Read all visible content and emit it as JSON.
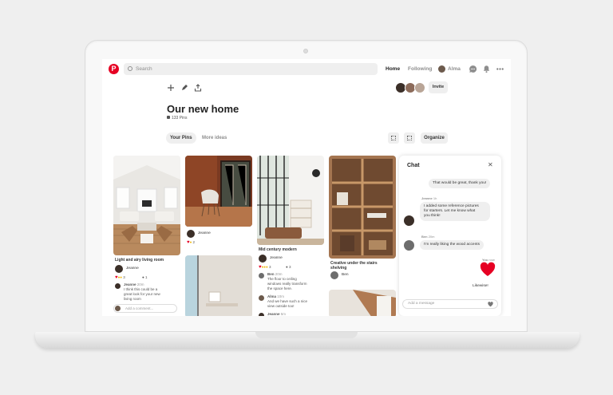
{
  "topbar": {
    "search_placeholder": "Search",
    "nav": {
      "home": "Home",
      "following": "Following",
      "user": "Alma"
    }
  },
  "board": {
    "title": "Our new home",
    "pin_count": "133 Pins",
    "invite_label": "Invite",
    "tabs": [
      "Your Pins",
      "More ideas"
    ],
    "organize_label": "Organize"
  },
  "pins": {
    "p1": {
      "caption": "Light and airy living room",
      "user": "Jeanne",
      "reactions": "3",
      "comments": "1",
      "comment": {
        "user": "Jeanne",
        "time": "20m",
        "text": [
          "I think this could be a",
          "great look for your new",
          "living room"
        ]
      },
      "add_comment": "Add a comment..."
    },
    "p2": {
      "user": "Jeanne",
      "reactions": "2"
    },
    "p3": {
      "caption": "Mid century modern",
      "user": "Jeanne",
      "reactions": "3",
      "comments": "3",
      "comments_list": [
        {
          "user": "Ben",
          "time": "20m",
          "text": [
            "The floor to ceiling",
            "windows really transform",
            "the space here."
          ]
        },
        {
          "user": "Alma",
          "time": "10m",
          "text": [
            "And we have such a nice",
            "view outside too!"
          ]
        },
        {
          "user": "Jeanne",
          "time": "5m",
          "text": [
            ""
          ]
        }
      ]
    },
    "p4": {
      "caption": [
        "Creative under the stairs",
        "shelving"
      ],
      "user": "Ben"
    }
  },
  "chat": {
    "title": "Chat",
    "messages": [
      {
        "text": "That would be great, thank you!"
      },
      {
        "user": "Jeanne",
        "time": "1h",
        "text": [
          "I added some reference pictures",
          "for starters. Let me know what",
          "you think!"
        ]
      },
      {
        "user": "Ben",
        "time": "20m",
        "text": "I'm really liking the wood accents"
      },
      {
        "user": "You",
        "time": "now",
        "text": "Likewise!"
      }
    ],
    "input_placeholder": "Add a message"
  },
  "colors": {
    "brand": "#e60023",
    "surface": "#efefef"
  }
}
